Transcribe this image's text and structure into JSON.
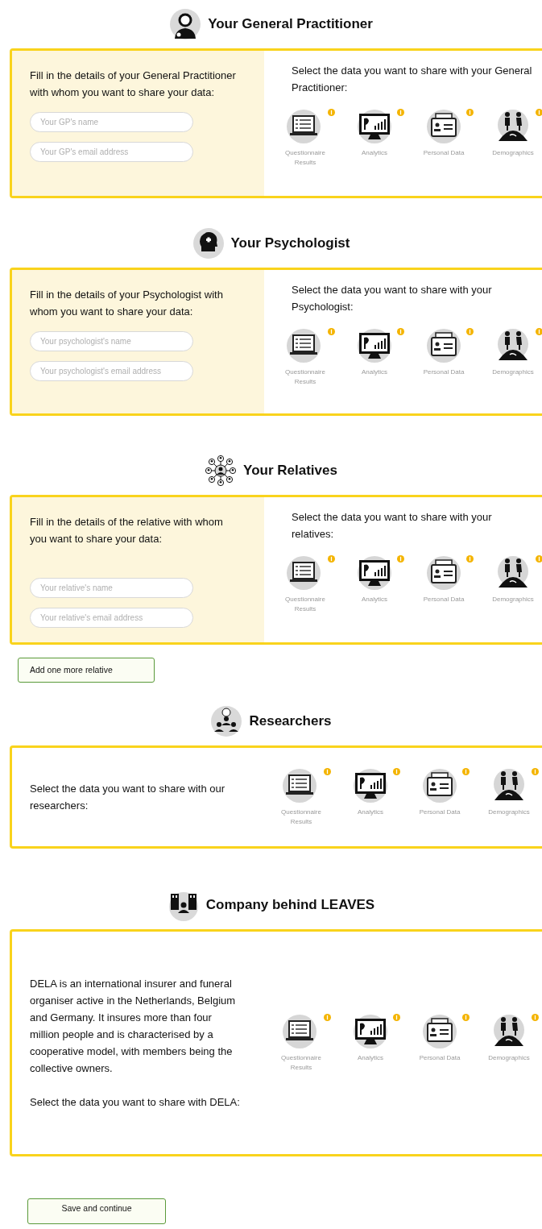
{
  "sections": [
    {
      "kind": "form",
      "title": "Your General Practitioner",
      "intro": "Fill in the details of your General Practitioner with whom you want to share your data:",
      "fields": [
        {
          "placeholder": "Your GP's name"
        },
        {
          "placeholder": "Your GP's email address"
        }
      ],
      "share_prompt": "Select the data you want to share with your General Practitioner:",
      "options": [
        "Questionnaire Results",
        "Analytics",
        "Personal Data",
        "Demographics"
      ]
    },
    {
      "kind": "form",
      "title": "Your Psychologist",
      "intro": "Fill in the details of your Psychologist with whom you want to share your data:",
      "fields": [
        {
          "placeholder": "Your psychologist's name"
        },
        {
          "placeholder": "Your psychologist's email address"
        }
      ],
      "share_prompt": "Select the data you want to share with your Psychologist:",
      "options": [
        "Questionnaire Results",
        "Analytics",
        "Personal Data",
        "Demographics"
      ]
    },
    {
      "kind": "form",
      "title": "Your Relatives",
      "intro": "Fill in the details of the relative with whom you want to share your data:",
      "fields": [
        {
          "placeholder": "Your relative's name"
        },
        {
          "placeholder": "Your relative's email address"
        }
      ],
      "share_prompt": "Select the data you want to share with your relatives:",
      "options": [
        "Questionnaire Results",
        "Analytics",
        "Personal Data",
        "Demographics"
      ],
      "button": "Add one more relative"
    },
    {
      "kind": "text",
      "title": "Researchers",
      "paragraphs": [
        "Select the data you want to share with our researchers:"
      ],
      "options": [
        "Questionnaire Results",
        "Analytics",
        "Personal Data",
        "Demographics"
      ]
    },
    {
      "kind": "text",
      "title": "Company behind LEAVES",
      "paragraphs": [
        "DELA is an international insurer and funeral organiser active in the Netherlands, Belgium and Germany. It insures more than four million people and is characterised by a cooperative model, with members being the collective owners.",
        "Select the data you want to share with DELA:"
      ],
      "options": [
        "Questionnaire Results",
        "Analytics",
        "Personal Data",
        "Demographics"
      ]
    }
  ],
  "save_button": "Save and continue"
}
